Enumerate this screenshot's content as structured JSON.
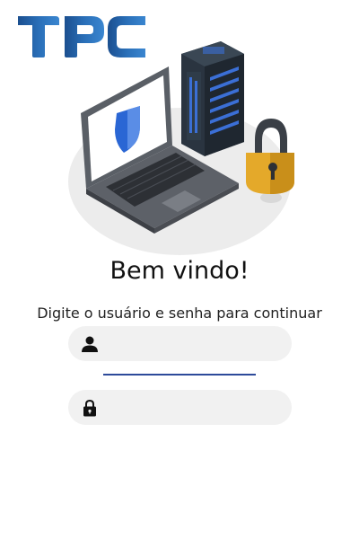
{
  "app": {
    "logo_text": "TPC",
    "brand_color": "#1f5fa8"
  },
  "login": {
    "title": "Bem vindo!",
    "subtitle": "Digite o usuário e senha para continuar",
    "username": {
      "value": "",
      "placeholder": "",
      "icon": "user-icon"
    },
    "password": {
      "value": "",
      "placeholder": "",
      "icon": "lock-icon"
    },
    "underline_color": "#2d4a9a"
  }
}
